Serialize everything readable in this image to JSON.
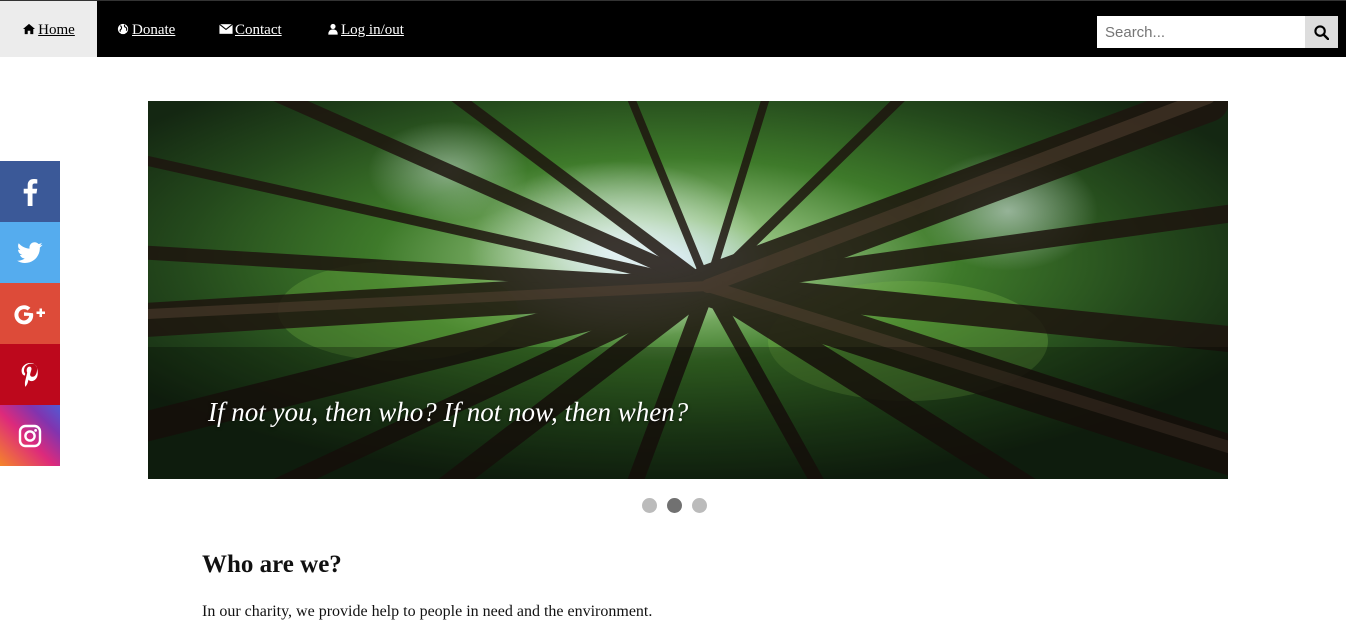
{
  "nav": {
    "home": "Home",
    "donate": "Donate",
    "contact": "Contact",
    "login": "Log in/out",
    "icons": [
      "home-icon",
      "globe-icon",
      "envelope-icon",
      "user-icon"
    ]
  },
  "search": {
    "placeholder": "Search...",
    "value": "",
    "button_icon": "search-icon"
  },
  "social": {
    "items": [
      "facebook",
      "twitter",
      "google-plus",
      "pinterest",
      "instagram"
    ],
    "colors": {
      "facebook": "#3b5998",
      "twitter": "#55acee",
      "google-plus": "#dd4b39",
      "pinterest": "#bd081c"
    }
  },
  "slideshow": {
    "caption": "If not you, then who? If not now, then when?",
    "slide_count": 3,
    "active_index": 2
  },
  "content": {
    "heading": "Who are we?",
    "intro": "In our charity, we provide help to people in need and the environment."
  }
}
